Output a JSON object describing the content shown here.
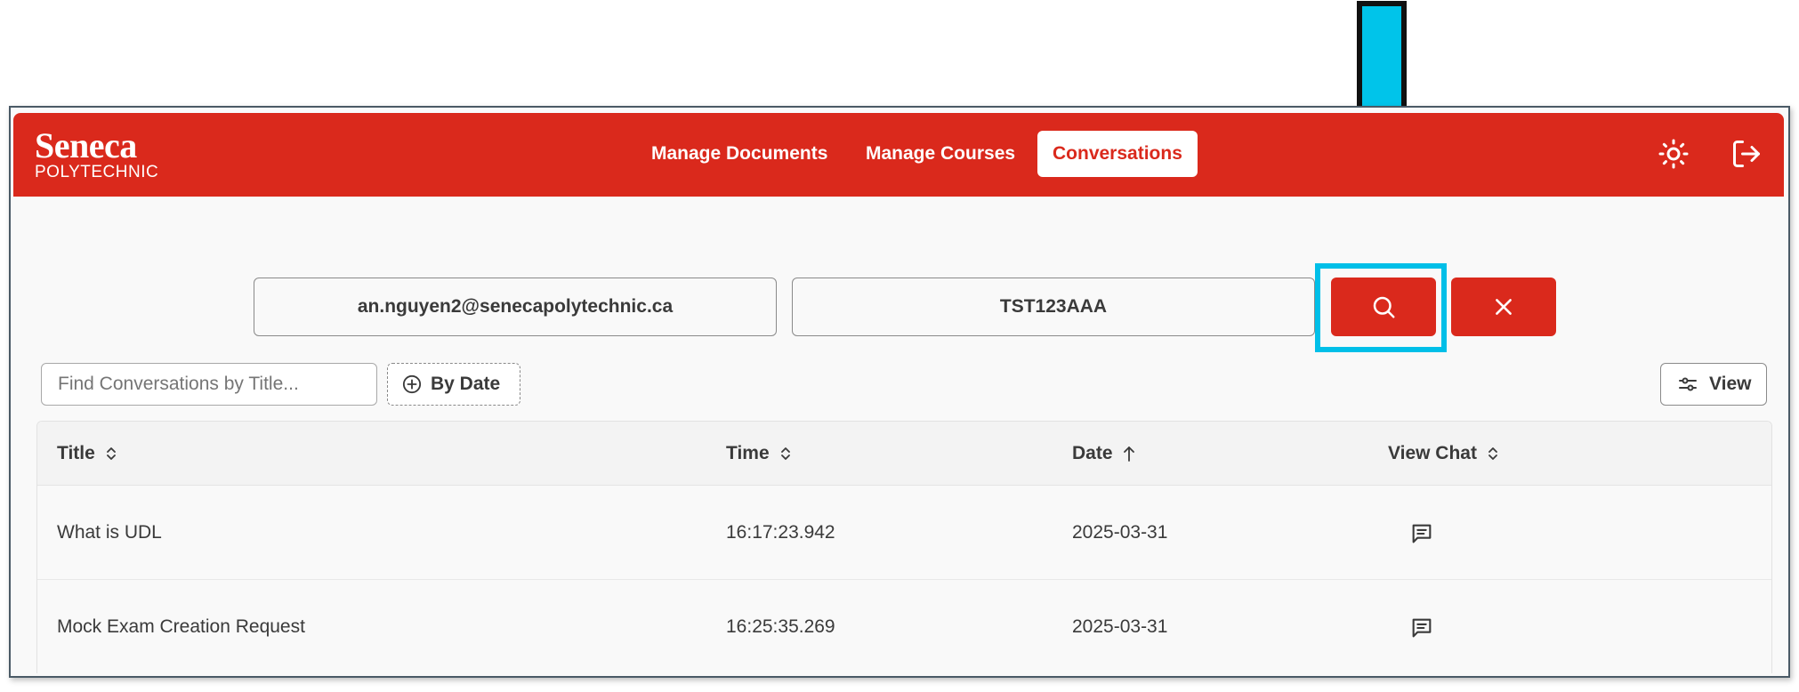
{
  "brand": {
    "name": "Seneca",
    "subtitle": "POLYTECHNIC"
  },
  "nav": {
    "items": [
      {
        "label": "Manage Documents",
        "active": false
      },
      {
        "label": "Manage Courses",
        "active": false
      },
      {
        "label": "Conversations",
        "active": true
      }
    ]
  },
  "header_icons": [
    "theme-sun-icon",
    "logout-icon"
  ],
  "search": {
    "email_value": "an.nguyen2@senecapolytechnic.ca",
    "course_value": "TST123AAA",
    "search_button_icon": "search-icon",
    "clear_button_icon": "close-icon"
  },
  "filters": {
    "title_placeholder": "Find Conversations by Title...",
    "by_date_label": "By Date",
    "view_label": "View"
  },
  "table": {
    "columns": [
      {
        "label": "Title",
        "sort": "none"
      },
      {
        "label": "Time",
        "sort": "none"
      },
      {
        "label": "Date",
        "sort": "ascending"
      },
      {
        "label": "View Chat",
        "sort": "none"
      }
    ],
    "rows": [
      {
        "title": "What is UDL",
        "time": "16:17:23.942",
        "date": "2025-03-31",
        "view_chat_icon": "message-icon"
      },
      {
        "title": "Mock Exam Creation Request",
        "time": "16:25:35.269",
        "date": "2025-03-31",
        "view_chat_icon": "message-icon"
      }
    ]
  },
  "colors": {
    "brand_red": "#da291c",
    "annotation_cyan": "#00bfe8"
  }
}
